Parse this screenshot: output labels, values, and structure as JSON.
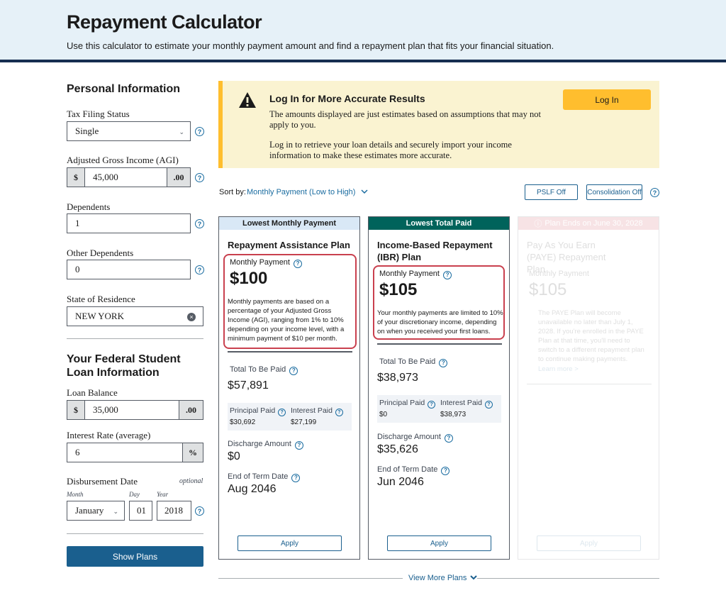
{
  "header": {
    "title": "Repayment Calculator",
    "subtitle": "Use this calculator to estimate your monthly payment amount and find a repayment plan that fits your financial situation."
  },
  "sidebar": {
    "personal_heading": "Personal Information",
    "tax_label": "Tax Filing Status",
    "tax_value": "Single",
    "agi_label": "Adjusted Gross Income (AGI)",
    "agi_prefix": "$",
    "agi_value": "45,000",
    "agi_suffix": ".00",
    "dependents_label": "Dependents",
    "dependents_value": "1",
    "other_dependents_label": "Other Dependents",
    "other_dependents_value": "0",
    "state_label": "State of Residence",
    "state_value": "NEW YORK",
    "loan_heading": "Your Federal Student Loan Information",
    "balance_label": "Loan Balance",
    "balance_prefix": "$",
    "balance_value": "35,000",
    "balance_suffix": ".00",
    "rate_label": "Interest Rate (average)",
    "rate_value": "6",
    "rate_suffix": "%",
    "disb_label": "Disbursement Date",
    "disb_optional": "optional",
    "month_label": "Month",
    "month_value": "January",
    "day_label": "Day",
    "day_value": "01",
    "year_label": "Year",
    "year_value": "2018",
    "show_plans": "Show Plans"
  },
  "alert": {
    "title": "Log In for More Accurate Results",
    "text1": "The amounts displayed are just estimates based on assumptions that may not apply to you.",
    "text2": "Log in to retrieve your loan details and securely import your income information to make these estimates more accurate.",
    "button": "Log In"
  },
  "sort": {
    "label": "Sort by:",
    "value": "Monthly Payment (Low to High)",
    "pslf": "PSLF Off",
    "consolidation": "Consolidation Off"
  },
  "cards": [
    {
      "badge": "Lowest Monthly Payment",
      "title": "Repayment Assistance Plan",
      "mp_label": "Monthly Payment",
      "mp_amount": "$100",
      "mp_desc": "Monthly payments are based on a percentage of your Adjusted Gross Income (AGI), ranging from 1% to 10% depending on your income level, with a minimum payment of $10 per month.",
      "total_label": "Total To Be Paid",
      "total_value": "$57,891",
      "principal_label": "Principal Paid",
      "principal_value": "$30,692",
      "interest_label": "Interest Paid",
      "interest_value": "$27,199",
      "discharge_label": "Discharge Amount",
      "discharge_value": "$0",
      "term_label": "End of Term Date",
      "term_value": "Aug 2046",
      "apply": "Apply",
      "colors": {
        "badge_bg": "#d9e8f6",
        "badge_fg": "#1b1b1b"
      }
    },
    {
      "badge": "Lowest Total Paid",
      "title": "Income-Based Repayment (IBR) Plan",
      "mp_label": "Monthly Payment",
      "mp_amount": "$105",
      "mp_desc": "Your monthly payments are limited to 10% of your discretionary income, depending on when you received your first loans.",
      "total_label": "Total To Be Paid",
      "total_value": "$38,973",
      "principal_label": "Principal Paid",
      "principal_value": "$0",
      "interest_label": "Interest Paid",
      "interest_value": "$38,973",
      "discharge_label": "Discharge Amount",
      "discharge_value": "$35,626",
      "term_label": "End of Term Date",
      "term_value": "Jun 2046",
      "apply": "Apply",
      "colors": {
        "badge_bg": "#00635b",
        "badge_fg": "#ffffff"
      }
    },
    {
      "badge": "Plan Ends on June 30, 2028",
      "title": "Pay As You Earn (PAYE) Repayment Plan",
      "mp_label": "Monthly Payment",
      "mp_amount": "$105",
      "mp_desc": "The PAYE Plan will become unavailable no later than July 1, 2028. If you're enrolled in the PAYE Plan at that time, you'll need to switch to a different repayment plan to continue making payments.",
      "learn_more": "Learn more >",
      "apply": "Apply",
      "colors": {
        "badge_bg": "#e5a3a9",
        "badge_fg": "#ffffff"
      }
    }
  ],
  "view_more": "View More Plans",
  "colors": {
    "accent": "#1a5f8e",
    "alert_bg": "#faf3d1",
    "alert_border": "#ffbe2e",
    "highlight": "#c9404e",
    "header_bg": "#e6f1f8",
    "header_rule": "#162e51"
  }
}
